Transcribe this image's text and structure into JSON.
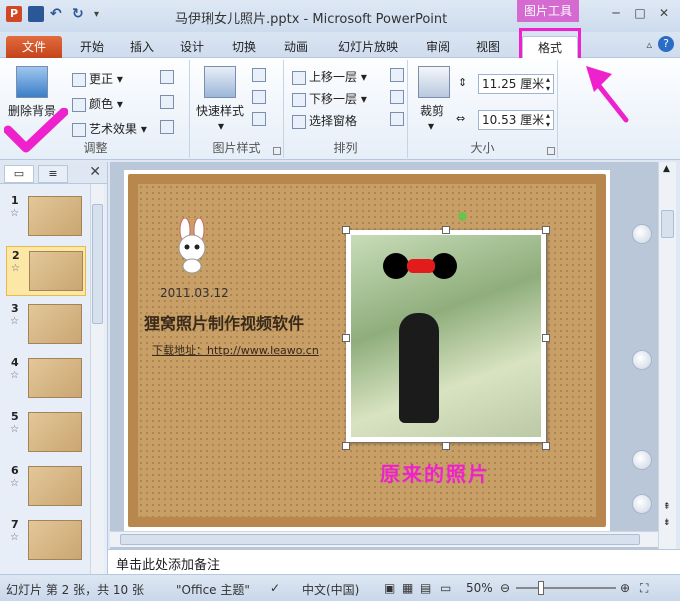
{
  "window": {
    "title": "马伊琍女儿照片.pptx - Microsoft PowerPoint",
    "context_tab": "图片工具",
    "app_icon_letter": "P"
  },
  "tabs": [
    {
      "label": "文件"
    },
    {
      "label": "开始"
    },
    {
      "label": "插入"
    },
    {
      "label": "设计"
    },
    {
      "label": "切换"
    },
    {
      "label": "动画"
    },
    {
      "label": "幻灯片放映"
    },
    {
      "label": "审阅"
    },
    {
      "label": "视图"
    },
    {
      "label": "格式"
    }
  ],
  "ribbon": {
    "adjust": {
      "label": "调整",
      "remove_bg": "删除背景",
      "corrections": "更正",
      "color": "颜色",
      "artistic": "艺术效果"
    },
    "picture_styles": {
      "label": "图片样式",
      "quick_styles": "快速样式"
    },
    "arrange": {
      "label": "排列",
      "bring_forward": "上移一层",
      "send_backward": "下移一层",
      "selection_pane": "选择窗格"
    },
    "size": {
      "label": "大小",
      "crop": "裁剪",
      "height": "11.25 厘米",
      "width": "10.53 厘米"
    }
  },
  "slides_panel": {
    "thumbs": [
      {
        "num": "1",
        "star": "☆"
      },
      {
        "num": "2",
        "star": "☆"
      },
      {
        "num": "3",
        "star": "☆"
      },
      {
        "num": "4",
        "star": "☆"
      },
      {
        "num": "5",
        "star": "☆"
      },
      {
        "num": "6",
        "star": "☆"
      },
      {
        "num": "7",
        "star": "☆"
      }
    ]
  },
  "slide": {
    "date": "2011.03.12",
    "headline": "狸窝照片制作视频软件",
    "download": "下载地址：http://www.leawo.cn",
    "caption": "原来的照片"
  },
  "notes": {
    "placeholder": "单击此处添加备注"
  },
  "status": {
    "slide_info": "幻灯片 第 2 张，共 10 张",
    "theme": "\"Office 主题\"",
    "language": "中文(中国)",
    "zoom": "50%"
  },
  "colors": {
    "highlight": "#ee22cc",
    "file_tab": "#d24726",
    "context_tab": "#d56bd0"
  }
}
